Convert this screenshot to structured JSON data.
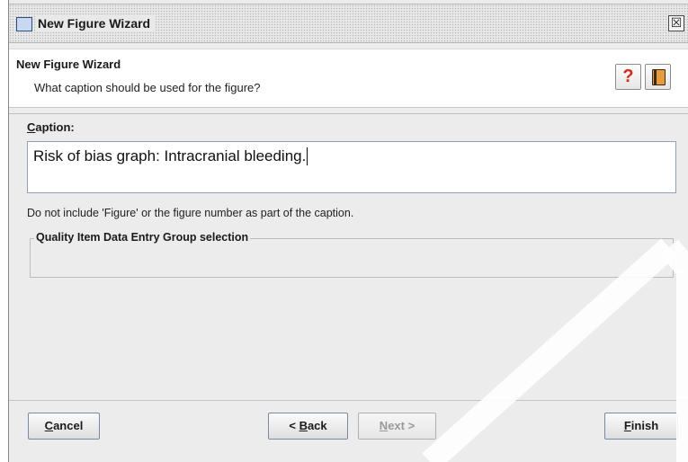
{
  "window": {
    "title": "New Figure Wizard",
    "close_glyph": "☒"
  },
  "header": {
    "title": "New Figure Wizard",
    "subtitle": "What caption should be used for the figure?",
    "help_icon": "question-mark-icon",
    "help_glyph": "?",
    "book_icon": "book-icon"
  },
  "form": {
    "caption_label_mnemonic": "C",
    "caption_label_rest": "aption:",
    "caption_value": "Risk of bias graph: Intracranial bleeding.",
    "hint": "Do not include 'Figure' or the figure number as part of the caption.",
    "group_title": "Quality Item Data Entry Group selection"
  },
  "buttons": {
    "cancel_mnemonic": "C",
    "cancel_rest": "ancel",
    "back_prefix": "< ",
    "back_mnemonic": "B",
    "back_rest": "ack",
    "next_mnemonic": "N",
    "next_rest": "ext >",
    "finish_mnemonic": "F",
    "finish_rest": "inish"
  },
  "colors": {
    "window_bg": "#ececec",
    "help_icon": "#d12b18",
    "book_icon": "#e79b3b"
  }
}
